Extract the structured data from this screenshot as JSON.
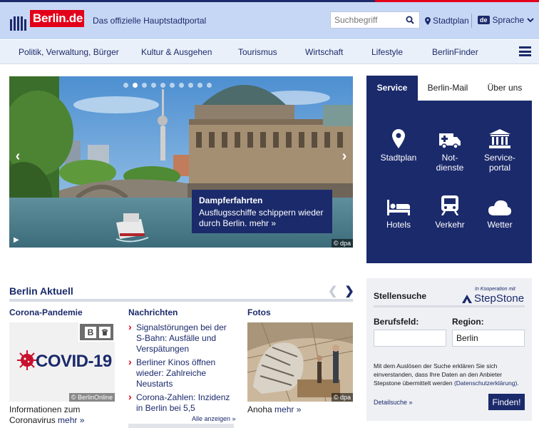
{
  "header": {
    "logo_text": "Berlin.de",
    "tagline": "Das offizielle Hauptstadtportal",
    "search_placeholder": "Suchbegriff",
    "stadtplan_label": "Stadtplan",
    "sprache_badge": "de",
    "sprache_label": "Sprache"
  },
  "nav": {
    "items": [
      "Politik, Verwaltung, Bürger",
      "Kultur & Ausgehen",
      "Tourismus",
      "Wirtschaft",
      "Lifestyle",
      "BerlinFinder"
    ]
  },
  "slider": {
    "caption_title": "Dampferfahrten",
    "caption_text": "Ausflugsschiffe schippern wieder durch Berlin. mehr »",
    "credit": "© dpa",
    "slide_count": 10,
    "active_slide": 2
  },
  "service": {
    "tabs": [
      "Service",
      "Berlin-Mail",
      "Über uns"
    ],
    "active_tab": "Service",
    "items": [
      {
        "label": "Stadtplan",
        "icon": "map-pin-icon"
      },
      {
        "label": "Not-\ndienste",
        "icon": "ambulance-icon"
      },
      {
        "label": "Service-\nportal",
        "icon": "building-icon"
      },
      {
        "label": "Hotels",
        "icon": "bed-icon"
      },
      {
        "label": "Verkehr",
        "icon": "train-icon"
      },
      {
        "label": "Wetter",
        "icon": "cloud-icon"
      }
    ]
  },
  "aktuell": {
    "title": "Berlin Aktuell",
    "columns": {
      "corona": {
        "title": "Corona-Pandemie",
        "image_text": "COVID-19",
        "badge_letters": [
          "B",
          "♛"
        ],
        "credit": "© BerlinOnline",
        "caption": "Informationen zum Coronavirus",
        "more": "mehr »"
      },
      "news": {
        "title": "Nachrichten",
        "items": [
          "Signalstörungen bei der S-Bahn: Ausfälle und Verspätungen",
          "Berliner Kinos öffnen wieder: Zahlreiche Neustarts",
          "Corona-Zahlen: Inzidenz in Berlin bei 5,5"
        ],
        "all_link": "Alle anzeigen »"
      },
      "photos": {
        "title": "Fotos",
        "credit": "© dpa",
        "caption": "Anoha",
        "more": "mehr »"
      }
    }
  },
  "jobs": {
    "title": "Stellensuche",
    "cooperation": "In Kooperation mit",
    "partner": "StepStone",
    "field_label": "Berufsfeld:",
    "field_value": "",
    "region_label": "Region:",
    "region_value": "Berlin",
    "note": "Mit dem Auslösen der Suche erklären Sie sich einverstanden, dass Ihre Daten an den Anbieter Stepstone übermittelt werden",
    "note_link": "(Datenschutzerklärung)",
    "detail_link": "Detailsuche »",
    "submit": "Finden!"
  },
  "colors": {
    "primary": "#1b2a6b",
    "accent": "#e2001a",
    "header_bg": "#c6d7f5"
  }
}
